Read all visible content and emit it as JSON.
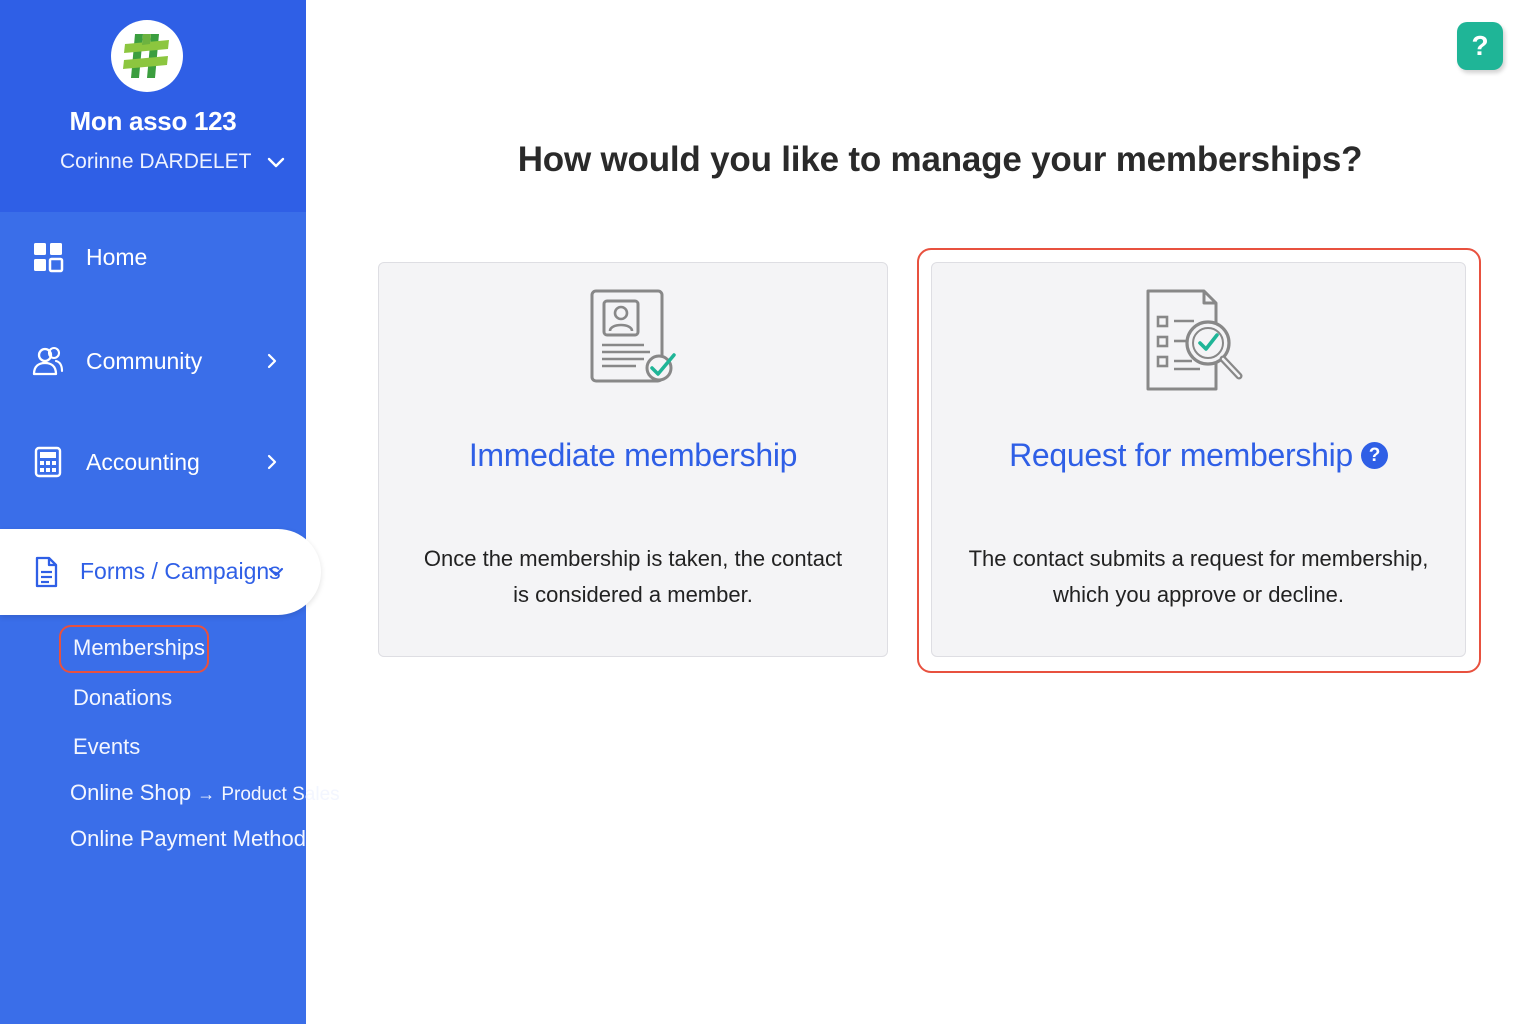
{
  "sidebar": {
    "org_name": "Mon asso 123",
    "user_name": "Corinne DARDELET",
    "nav": {
      "home": "Home",
      "community": "Community",
      "accounting": "Accounting",
      "forms_campaigns": "Forms / Campaigns"
    },
    "sub_items": {
      "memberships": "Memberships",
      "donations": "Donations",
      "events": "Events",
      "online_shop": "Online Shop",
      "product_sales": "Product Sales",
      "online_payment": "Online Payment Method"
    },
    "arrow": "→"
  },
  "help": {
    "label": "?"
  },
  "main": {
    "title": "How would you like to manage your memberships?",
    "cards": {
      "immediate": {
        "title": "Immediate membership",
        "line1": "Once the membership is taken, the contact",
        "line2": "is considered a member."
      },
      "request": {
        "title": "Request for membership",
        "line1": "The contact submits a request for membership,",
        "line2": "which you approve or decline."
      }
    },
    "info_badge": "?"
  },
  "colors": {
    "sidebar": "#3a6ee9",
    "sidebar_header": "#2f5fe6",
    "accent_blue": "#2f5fe6",
    "highlight_red": "#e8513f",
    "help_green": "#1fb597",
    "check_teal": "#1fb597"
  }
}
